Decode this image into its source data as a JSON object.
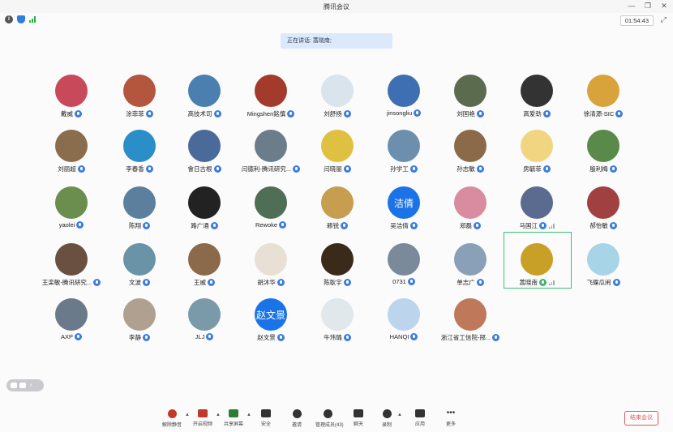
{
  "window": {
    "title": "腾讯会议",
    "minimize": "—",
    "restore": "❐",
    "close": "✕"
  },
  "status": {
    "timer": "01:54:43",
    "fullscreen_icon": "⤢"
  },
  "speaking": {
    "label": "正在讲话: 蒿晓南;"
  },
  "participants": [
    {
      "name": "戴威",
      "mic": "on",
      "color": "#c84a5a"
    },
    {
      "name": "涂菲菲",
      "mic": "on",
      "color": "#b4553d"
    },
    {
      "name": "高技术司",
      "mic": "on",
      "color": "#4a7fb0"
    },
    {
      "name": "Mingshen銘慎",
      "mic": "on",
      "color": "#a33b2c"
    },
    {
      "name": "刘舒扬",
      "mic": "on",
      "color": "#d9e4ec"
    },
    {
      "name": "jinsongliu",
      "mic": "on",
      "color": "#3f6fb3"
    },
    {
      "name": "刘国艳",
      "mic": "on",
      "color": "#5b6b4e"
    },
    {
      "name": "高爱劲",
      "mic": "on",
      "color": "#333333"
    },
    {
      "name": "徐清源-SIC",
      "mic": "on",
      "color": "#d9a33c"
    },
    {
      "name": "刘丽超",
      "mic": "on",
      "color": "#8a6d4d"
    },
    {
      "name": "李春香",
      "mic": "on",
      "color": "#2a8ec8"
    },
    {
      "name": "會日古根",
      "mic": "on",
      "color": "#4a6a9a"
    },
    {
      "name": "闫德利-腾讯研究...",
      "mic": "on",
      "color": "#6b7c8a"
    },
    {
      "name": "闫晓丽",
      "mic": "on",
      "color": "#e0c040"
    },
    {
      "name": "孙学工",
      "mic": "on",
      "color": "#6d8fae"
    },
    {
      "name": "孙志敏",
      "mic": "on",
      "color": "#8b6a4a"
    },
    {
      "name": "房毓菲",
      "mic": "on",
      "color": "#f1d580"
    },
    {
      "name": "殷利梅",
      "mic": "on",
      "color": "#5a8a4a"
    },
    {
      "name": "yaolei",
      "mic": "on",
      "color": "#6b8e4e"
    },
    {
      "name": "陈翔",
      "mic": "on",
      "color": "#5d7f9e"
    },
    {
      "name": "路广通",
      "mic": "on",
      "color": "#222222"
    },
    {
      "name": "Rewoke",
      "mic": "on",
      "color": "#4e6f56"
    },
    {
      "name": "赖锐",
      "mic": "on",
      "color": "#c79d4f"
    },
    {
      "name": "吴洁倩",
      "mic": "on",
      "color": "#1b73e8",
      "initials": "洁倩"
    },
    {
      "name": "郑磊",
      "mic": "on",
      "color": "#d98ca0"
    },
    {
      "name": "马国江",
      "mic": "on",
      "color": "#5b6a8f"
    },
    {
      "name": "郝怡敏",
      "mic": "on",
      "color": "#a04040"
    },
    {
      "name": "王栾敏-腾讯研究...",
      "mic": "on",
      "color": "#6a5040"
    },
    {
      "name": "文波",
      "mic": "on",
      "color": "#6a93a8"
    },
    {
      "name": "王威",
      "mic": "on",
      "color": "#8a6a4a"
    },
    {
      "name": "胡沐华",
      "mic": "on",
      "color": "#e8e0d5"
    },
    {
      "name": "陈耿宇",
      "mic": "on",
      "color": "#3a2a1a"
    },
    {
      "name": "0731",
      "mic": "on",
      "color": "#7a8a9a"
    },
    {
      "name": "单志广",
      "mic": "on",
      "color": "#8aa0b8"
    },
    {
      "name": "蒿晓南",
      "mic": "speaking",
      "color": "#c8a028"
    },
    {
      "name": "飞碟瓜闹",
      "mic": "on",
      "color": "#a8d4e8"
    },
    {
      "name": "AXP",
      "mic": "on",
      "color": "#6a7a8a"
    },
    {
      "name": "李静",
      "mic": "on",
      "color": "#b0a090"
    },
    {
      "name": "JLJ",
      "mic": "on",
      "color": "#7a9aaa"
    },
    {
      "name": "赵文景",
      "mic": "on",
      "color": "#1b73e8",
      "initials": "赵文景"
    },
    {
      "name": "牛玮璐",
      "mic": "on",
      "color": "#e0e8ec"
    },
    {
      "name": "HANQI",
      "mic": "on",
      "color": "#bcd4ec"
    },
    {
      "name": "浙江省工信院-邢...",
      "mic": "on",
      "color": "#c0785a"
    }
  ],
  "toolbar": {
    "mute_label": "解除静音",
    "video_label": "开启视频",
    "share_label": "共享屏幕",
    "security_label": "安全",
    "invite_label": "邀请",
    "members_label": "管理成员(43)",
    "chat_label": "聊天",
    "record_label": "录制",
    "apps_label": "应用",
    "more_label": "更多",
    "end_label": "结束会议"
  }
}
